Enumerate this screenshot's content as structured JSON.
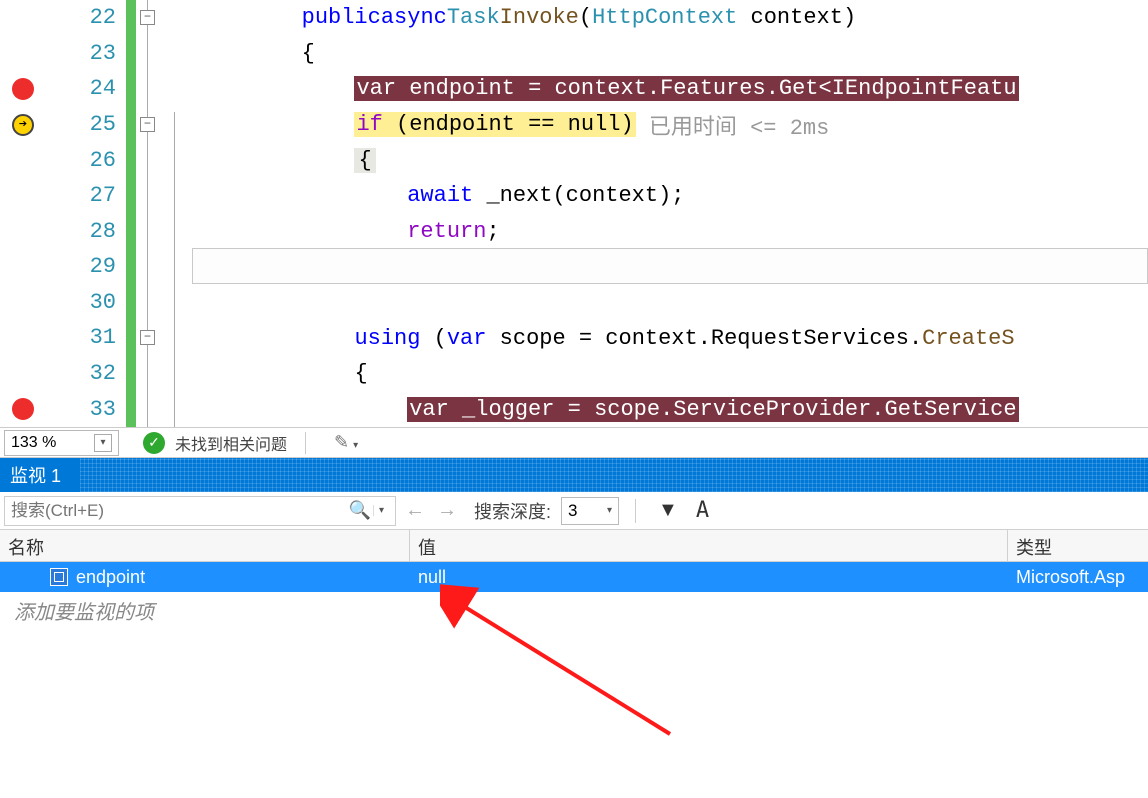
{
  "editor": {
    "lines": [
      {
        "n": 22,
        "fold": "minus"
      },
      {
        "n": 23
      },
      {
        "n": 24,
        "breakpoint": true
      },
      {
        "n": 25,
        "current": true,
        "fold": "minus"
      },
      {
        "n": 26
      },
      {
        "n": 27
      },
      {
        "n": 28
      },
      {
        "n": 29,
        "quickaction": true
      },
      {
        "n": 30
      },
      {
        "n": 31,
        "fold": "minus"
      },
      {
        "n": 32
      },
      {
        "n": 33,
        "breakpoint": true
      }
    ],
    "code": {
      "l22": {
        "indent": "        ",
        "kw1": "public",
        "kw2": "async",
        "type": "Task",
        "method": "Invoke",
        "paren_open": "(",
        "ptype": "HttpContext",
        "pname": " context",
        "paren_close": ")"
      },
      "l23": {
        "indent": "        ",
        "brace": "{"
      },
      "l24": {
        "indent": "            ",
        "text": "var endpoint = context.Features.Get<IEndpointFeatu"
      },
      "l25": {
        "indent": "            ",
        "kw": "if",
        "expr": " (endpoint == null)",
        "tail": " 已用时间 <= 2ms"
      },
      "l26": {
        "indent": "            ",
        "brace": "{"
      },
      "l27": {
        "indent": "                ",
        "kw": "await",
        "ident": " _next",
        "call": "(context);"
      },
      "l28": {
        "indent": "                ",
        "kw": "return",
        "semi": ";"
      },
      "l29": {
        "indent": "            ",
        "brace": "}"
      },
      "l30": {
        "indent": ""
      },
      "l31": {
        "indent": "            ",
        "kw": "using",
        "paren": " (",
        "kw2": "var",
        "ident": " scope = context.RequestServices.",
        "method": "CreateS"
      },
      "l32": {
        "indent": "            ",
        "brace": "{"
      },
      "l33": {
        "indent": "                ",
        "text": "var _logger = scope.ServiceProvider.GetService"
      }
    }
  },
  "status": {
    "zoom": "133 %",
    "no_issues": "未找到相关问题"
  },
  "watch": {
    "title": "监视 1",
    "search_placeholder": "搜索(Ctrl+E)",
    "depth_label": "搜索深度:",
    "depth_value": "3",
    "columns": {
      "name": "名称",
      "value": "值",
      "type": "类型"
    },
    "rows": [
      {
        "name": "endpoint",
        "value": "null",
        "type": "Microsoft.Asp"
      }
    ],
    "add_placeholder": "添加要监视的项"
  }
}
